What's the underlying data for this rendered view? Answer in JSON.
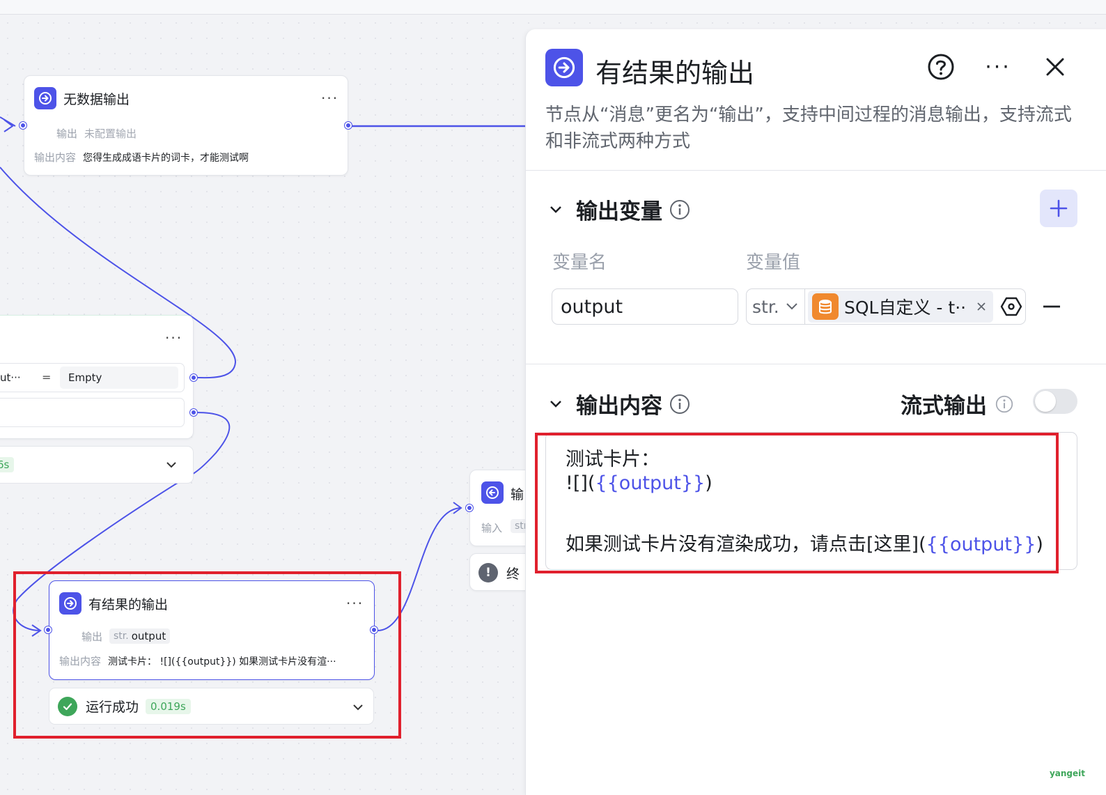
{
  "canvas": {
    "node_no_data": {
      "title": "无数据输出",
      "output_label": "输出",
      "output_value": "未配置输出",
      "content_label": "输出内容",
      "content_value": "您得生成成语卡片的词卡，才能测试啊"
    },
    "node_condition": {
      "left_value": "ut···",
      "operator": "=",
      "right_value": "Empty",
      "status_time_partial": "6s"
    },
    "node_partial_output": {
      "title_partial": "输",
      "input_label": "输入",
      "input_tag_partial": "str"
    },
    "node_end_partial": {
      "title_partial": "终"
    },
    "node_with_result": {
      "title": "有结果的输出",
      "output_label": "输出",
      "output_type": "str.",
      "output_name": "output",
      "content_label": "输出内容",
      "content_value": "测试卡片： ![]({{output}}) 如果测试卡片没有渲···"
    },
    "run_status": {
      "label": "运行成功",
      "time": "0.019s"
    }
  },
  "panel": {
    "title": "有结果的输出",
    "description": "节点从“消息”更名为“输出”，支持中间过程的消息输出，支持流式和非流式两种方式",
    "output_vars": {
      "title": "输出变量",
      "col_name": "变量名",
      "col_value": "变量值",
      "var_name": "output",
      "var_type": "str.",
      "var_ref": "SQL自定义 - t··"
    },
    "output_content": {
      "title": "输出内容",
      "stream_label": "流式输出",
      "stream_enabled": false,
      "line1": "测试卡片：",
      "line2_prefix": "![](",
      "line2_token": "{{output}}",
      "line2_suffix": ")",
      "line3_prefix": "如果测试卡片没有渲染成功，请点击[这里](",
      "line3_token": "{{output}}",
      "line3_suffix": ")"
    }
  },
  "watermark": "yangeit",
  "colors": {
    "accent": "#4d53e8",
    "highlight_box": "#e0202d",
    "success": "#3ea65a",
    "sql_icon": "#f0892e"
  }
}
